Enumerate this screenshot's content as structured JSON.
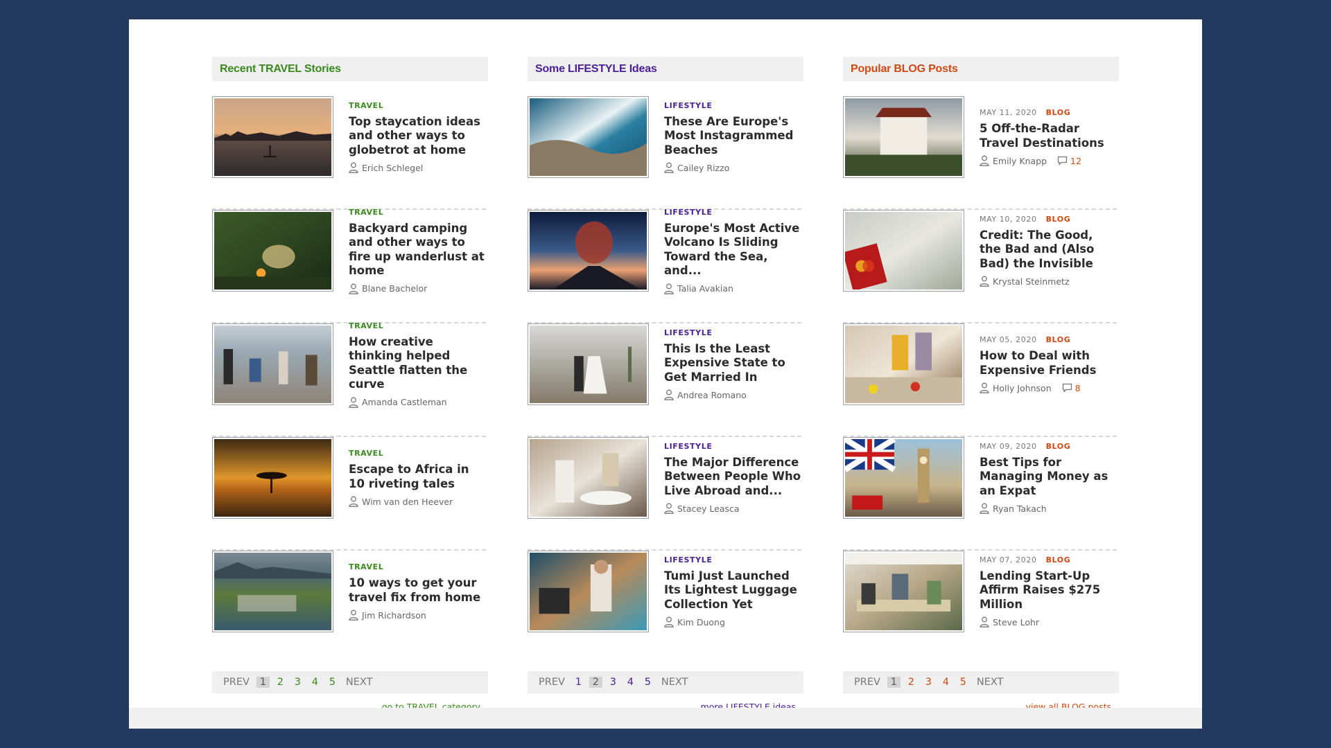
{
  "colors": {
    "background": "#223a5e",
    "travel_accent": "#3a8a1e",
    "lifestyle_accent": "#4a1f96",
    "blog_accent": "#cf4a12"
  },
  "travel": {
    "heading": "Recent TRAVEL Stories",
    "posts": [
      {
        "category": "TRAVEL",
        "title": "Top staycation ideas and other ways to globetrot at home",
        "author": "Erich Schlegel",
        "image": "sunset-lake-paddleboard-photo"
      },
      {
        "category": "TRAVEL",
        "title": "Backyard camping and other ways to fire up wanderlust at home",
        "author": "Blane Bachelor",
        "image": "backyard-campfire-tent-photo"
      },
      {
        "category": "TRAVEL",
        "title": "How creative thinking helped Seattle flatten the curve",
        "author": "Amanda Castleman",
        "image": "seattle-musicians-photo"
      },
      {
        "category": "TRAVEL",
        "title": "Escape to Africa in 10 riveting tales",
        "author": "Wim van den Heever",
        "image": "africa-savanna-sunset-tree-photo"
      },
      {
        "category": "TRAVEL",
        "title": "10 ways to get your travel fix from home",
        "author": "Jim Richardson",
        "image": "coastal-village-aerial-photo"
      }
    ],
    "pager": {
      "prev": "PREV",
      "pages": [
        "1",
        "2",
        "3",
        "4",
        "5"
      ],
      "active": "1",
      "next": "NEXT"
    },
    "more_link": "go to TRAVEL category"
  },
  "lifestyle": {
    "heading": "Some LIFESTYLE Ideas",
    "posts": [
      {
        "category": "LIFESTYLE",
        "title": "These Are Europe's Most Instagrammed Beaches",
        "author": "Cailey Rizzo",
        "image": "aerial-ocean-waves-beach-photo"
      },
      {
        "category": "LIFESTYLE",
        "title": "Europe's Most Active Volcano Is Sliding Toward the Sea, and...",
        "author": "Talia Avakian",
        "image": "erupting-volcano-photo"
      },
      {
        "category": "LIFESTYLE",
        "title": "This Is the Least Expensive State to Get Married In",
        "author": "Andrea Romano",
        "image": "wedding-couple-desert-photo"
      },
      {
        "category": "LIFESTYLE",
        "title": "The Major Difference Between People Who Live Abroad and...",
        "author": "Stacey Leasca",
        "image": "women-cafe-table-photo"
      },
      {
        "category": "LIFESTYLE",
        "title": "Tumi Just Launched Its Lightest Luggage Collection Yet",
        "author": "Kim Duong",
        "image": "man-boat-luggage-photo"
      }
    ],
    "pager": {
      "prev": "PREV",
      "pages": [
        "1",
        "2",
        "3",
        "4",
        "5"
      ],
      "active": "2",
      "next": "NEXT"
    },
    "more_link": "more LIFESTYLE ideas"
  },
  "blog": {
    "heading": "Popular BLOG Posts",
    "posts": [
      {
        "date": "MAY 11, 2020",
        "category": "BLOG",
        "title": "5 Off-the-Radar Travel Destinations",
        "author": "Emily Knapp",
        "comments": "12",
        "image": "bhutan-monastery-photo"
      },
      {
        "date": "MAY 10, 2020",
        "category": "BLOG",
        "title": "Credit: The Good, the Bad and (Also Bad) the Invisible",
        "author": "Krystal Steinmetz",
        "comments": "",
        "image": "credit-card-dollar-bills-photo"
      },
      {
        "date": "MAY 05, 2020",
        "category": "BLOG",
        "title": "How to Deal with Expensive Friends",
        "author": "Holly Johnson",
        "comments": "8",
        "image": "friends-kitchen-cooking-photo"
      },
      {
        "date": "MAY 09, 2020",
        "category": "BLOG",
        "title": "Best Tips for Managing Money as an Expat",
        "author": "Ryan Takach",
        "comments": "",
        "image": "london-big-ben-union-jack-photo"
      },
      {
        "date": "MAY 07, 2020",
        "category": "BLOG",
        "title": "Lending Start-Up Affirm Raises $275 Million",
        "author": "Steve Lohr",
        "comments": "",
        "image": "office-meeting-team-photo"
      }
    ],
    "pager": {
      "prev": "PREV",
      "pages": [
        "1",
        "2",
        "3",
        "4",
        "5"
      ],
      "active": "1",
      "next": "NEXT"
    },
    "more_link": "view all BLOG posts"
  }
}
